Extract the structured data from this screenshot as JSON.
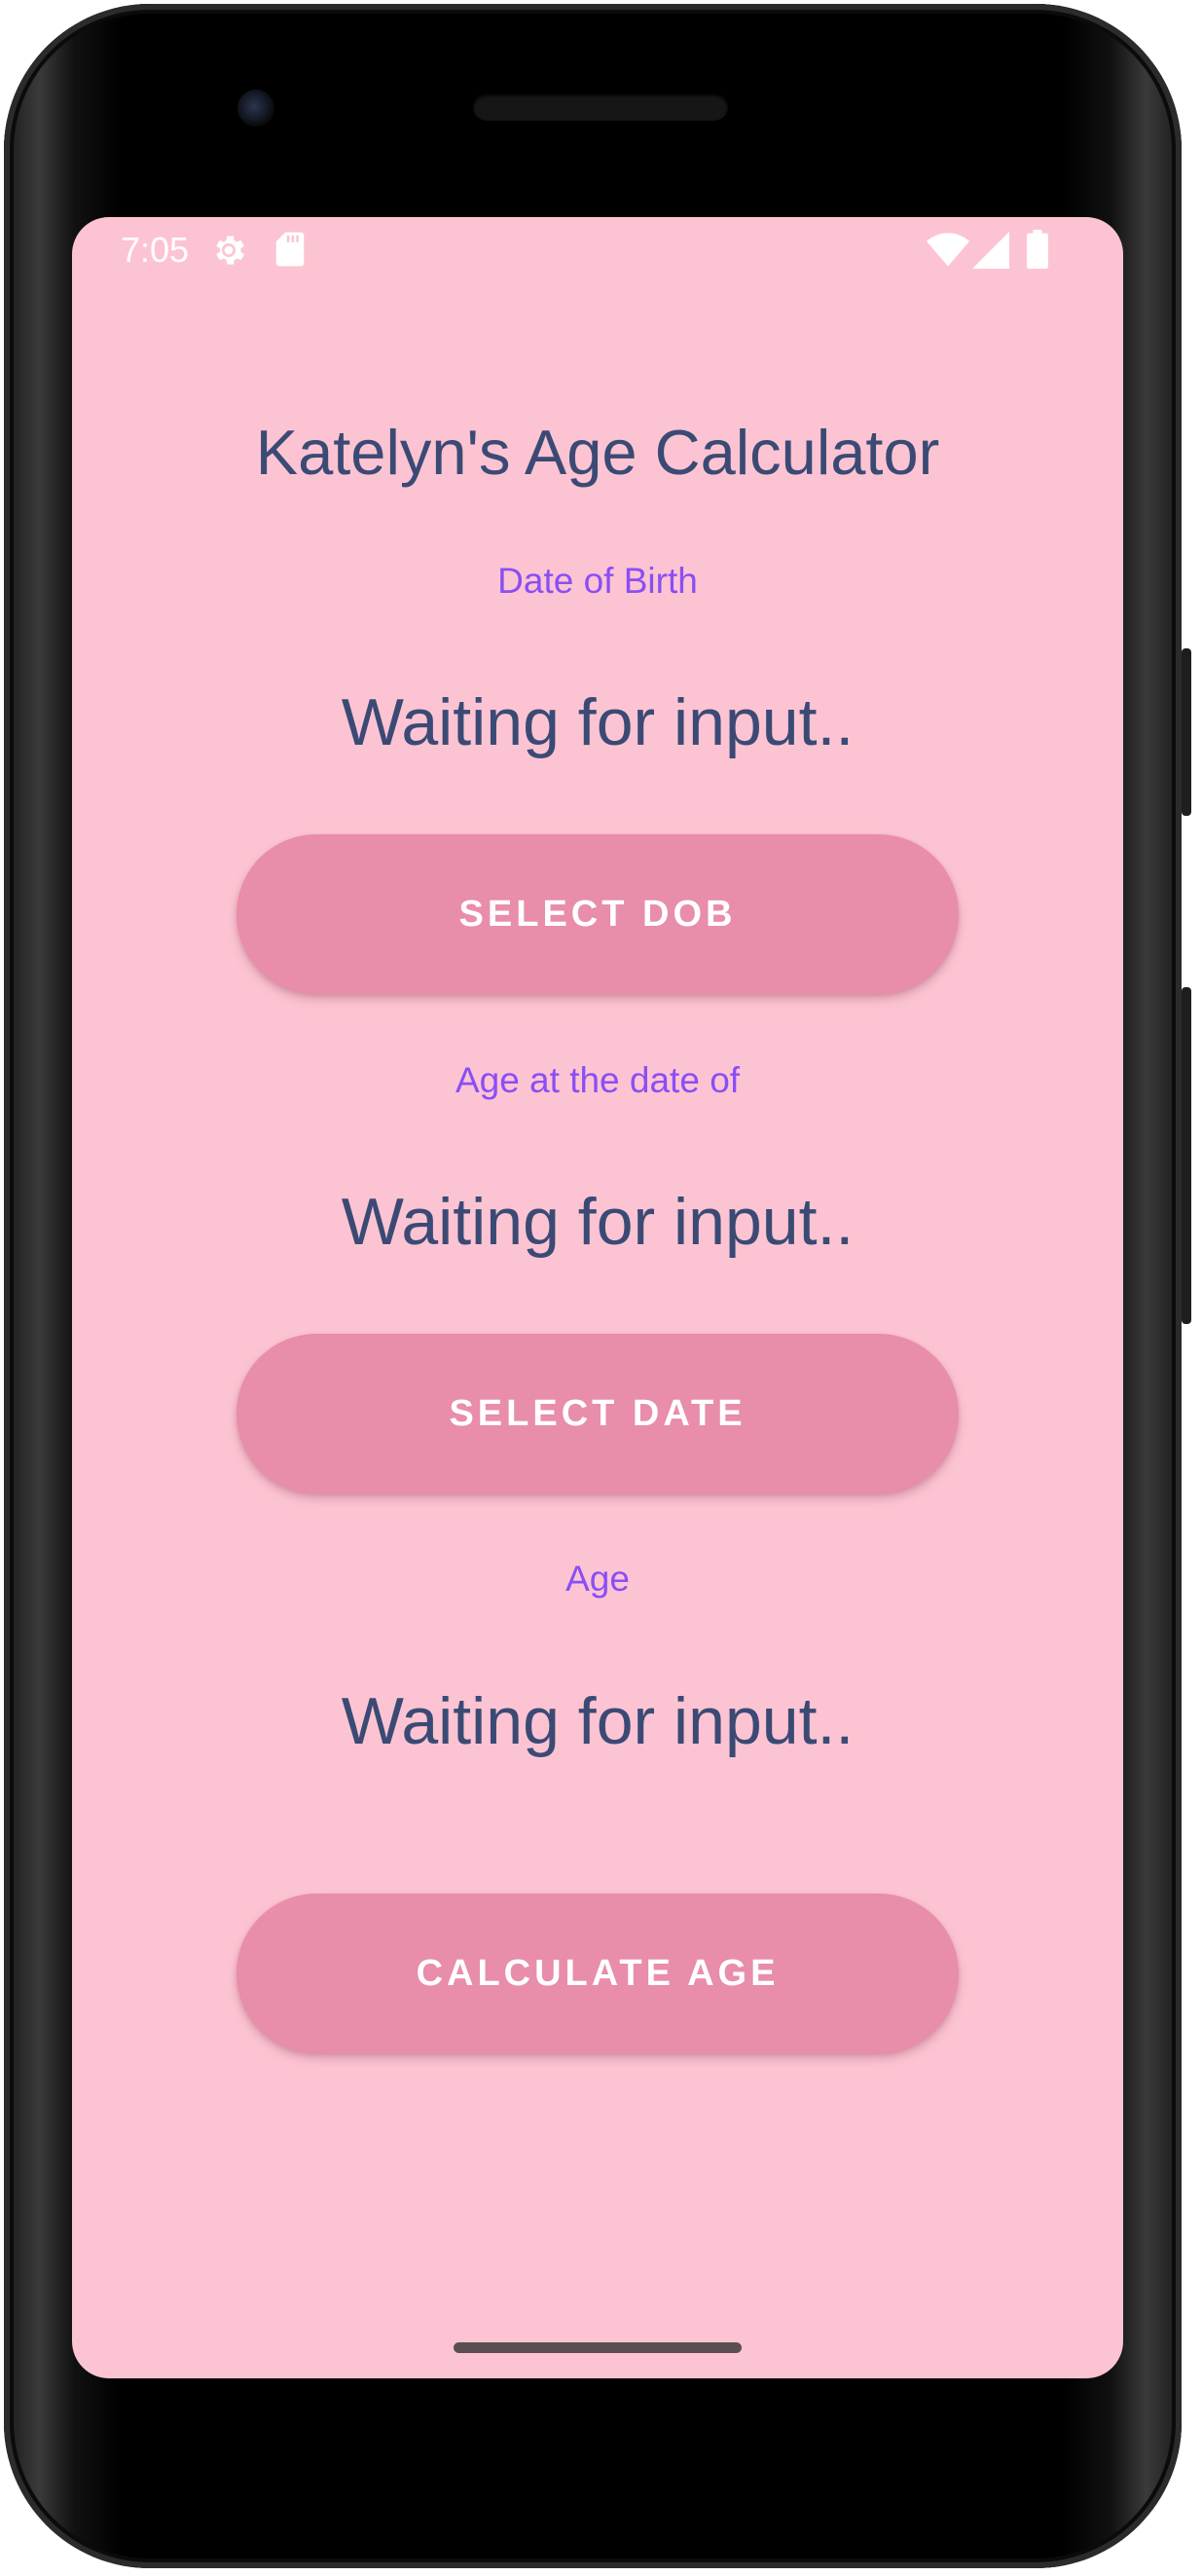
{
  "status_bar": {
    "time": "7:05",
    "icons": [
      "settings-gear-icon",
      "sd-card-icon",
      "wifi-icon",
      "cell-signal-icon",
      "battery-icon"
    ]
  },
  "app": {
    "title": "Katelyn's Age Calculator",
    "dob_label": "Date of Birth",
    "dob_value": "Waiting for input..",
    "select_dob_button": "SELECT DOB",
    "age_at_label": "Age at the date of",
    "age_at_value": "Waiting for input..",
    "select_date_button": "SELECT DATE",
    "age_label": "Age",
    "age_value": "Waiting for input..",
    "calculate_button": "CALCULATE AGE"
  },
  "colors": {
    "screen_background": "#fcc4d2",
    "button": "#e88daa",
    "button_text": "#ffffff",
    "title_text": "#3b4a75",
    "label_text": "#8a4ef5"
  }
}
